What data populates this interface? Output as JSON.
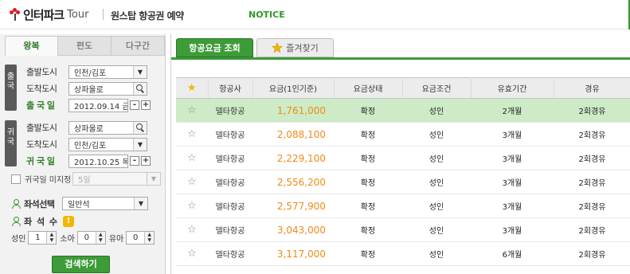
{
  "header": {
    "brand": "인터파크",
    "brand_sub": "Tour",
    "title": "원스탑 항공권 예약",
    "notice": "NOTICE"
  },
  "search": {
    "trip_tabs": [
      "왕복",
      "편도",
      "다구간"
    ],
    "active_tab": 0,
    "outbound_tag": "출국",
    "inbound_tag": "귀국",
    "outbound": {
      "depart_label": "출발도시",
      "depart_value": "인천/김포",
      "arrive_label": "도착도시",
      "arrive_value": "상파울로",
      "date_label": "출 국 일",
      "date_value": "2012.09.14 금"
    },
    "inbound": {
      "depart_label": "출발도시",
      "depart_value": "상파울로",
      "arrive_label": "도착도시",
      "arrive_value": "인천/김포",
      "date_label": "귀 국 일",
      "date_value": "2012.10.25 목"
    },
    "return_unset_label": "귀국일 미지정",
    "return_unset_value": "5일",
    "seat_class_label": "좌석선택",
    "seat_class_value": "일반석",
    "seat_count_label": "좌 석 수",
    "pax": {
      "adult_label": "성인",
      "adult_value": "1",
      "child_label": "소아",
      "child_value": "0",
      "infant_label": "유아",
      "infant_value": "0"
    },
    "search_button": "검색하기"
  },
  "results": {
    "tabs": [
      "항공요금 조회",
      "즐겨찾기"
    ],
    "columns": [
      "항공사",
      "요금(1인기준)",
      "요금상태",
      "요금조건",
      "유효기간",
      "경유"
    ],
    "rows": [
      {
        "airline": "델타항공",
        "price": "1,761,000",
        "status": "확정",
        "condition": "성인",
        "validity": "2개월",
        "stops": "2회경유"
      },
      {
        "airline": "델타항공",
        "price": "2,088,100",
        "status": "확정",
        "condition": "성인",
        "validity": "3개월",
        "stops": "2회경유"
      },
      {
        "airline": "델타항공",
        "price": "2,229,100",
        "status": "확정",
        "condition": "성인",
        "validity": "3개월",
        "stops": "2회경유"
      },
      {
        "airline": "델타항공",
        "price": "2,556,200",
        "status": "확정",
        "condition": "성인",
        "validity": "3개월",
        "stops": "2회경유"
      },
      {
        "airline": "델타항공",
        "price": "2,577,900",
        "status": "확정",
        "condition": "성인",
        "validity": "3개월",
        "stops": "2회경유"
      },
      {
        "airline": "델타항공",
        "price": "3,043,000",
        "status": "확정",
        "condition": "성인",
        "validity": "3개월",
        "stops": "2회경유"
      },
      {
        "airline": "델타항공",
        "price": "3,117,000",
        "status": "확정",
        "condition": "성인",
        "validity": "6개월",
        "stops": "2회경유"
      }
    ],
    "selected_row": 0
  },
  "colors": {
    "accent_green": "#3e9b39",
    "price_orange": "#f08a16",
    "selected_row": "#cdebc6",
    "brand_red": "#d81e24"
  }
}
